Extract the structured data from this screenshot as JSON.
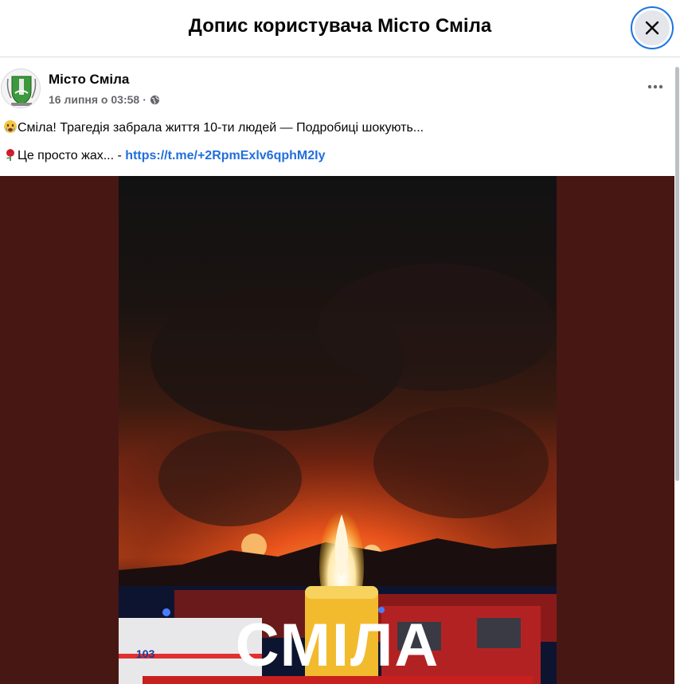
{
  "modal": {
    "title": "Допис користувача Місто Сміла"
  },
  "post": {
    "author": "Місто Сміла",
    "date": "16 липня о 03:58",
    "separator": "·",
    "text_line1": "Сміла! Трагедія забрала життя 10-ти людей — Подробиці шокують...",
    "text_line2_prefix": "Це просто жах... - ",
    "link": "https://t.me/+2RpmExlv6qphM2Iy",
    "line1_emoji": "crying-face-emoji",
    "line2_emoji": "red-rose-emoji"
  },
  "photo": {
    "overlay_text": "СМІЛА",
    "ambulance_number": "103",
    "colors": {
      "background": "#471714",
      "fire": "#e0501a",
      "overlay_text": "#ffffff",
      "link": "#216fdb"
    }
  }
}
